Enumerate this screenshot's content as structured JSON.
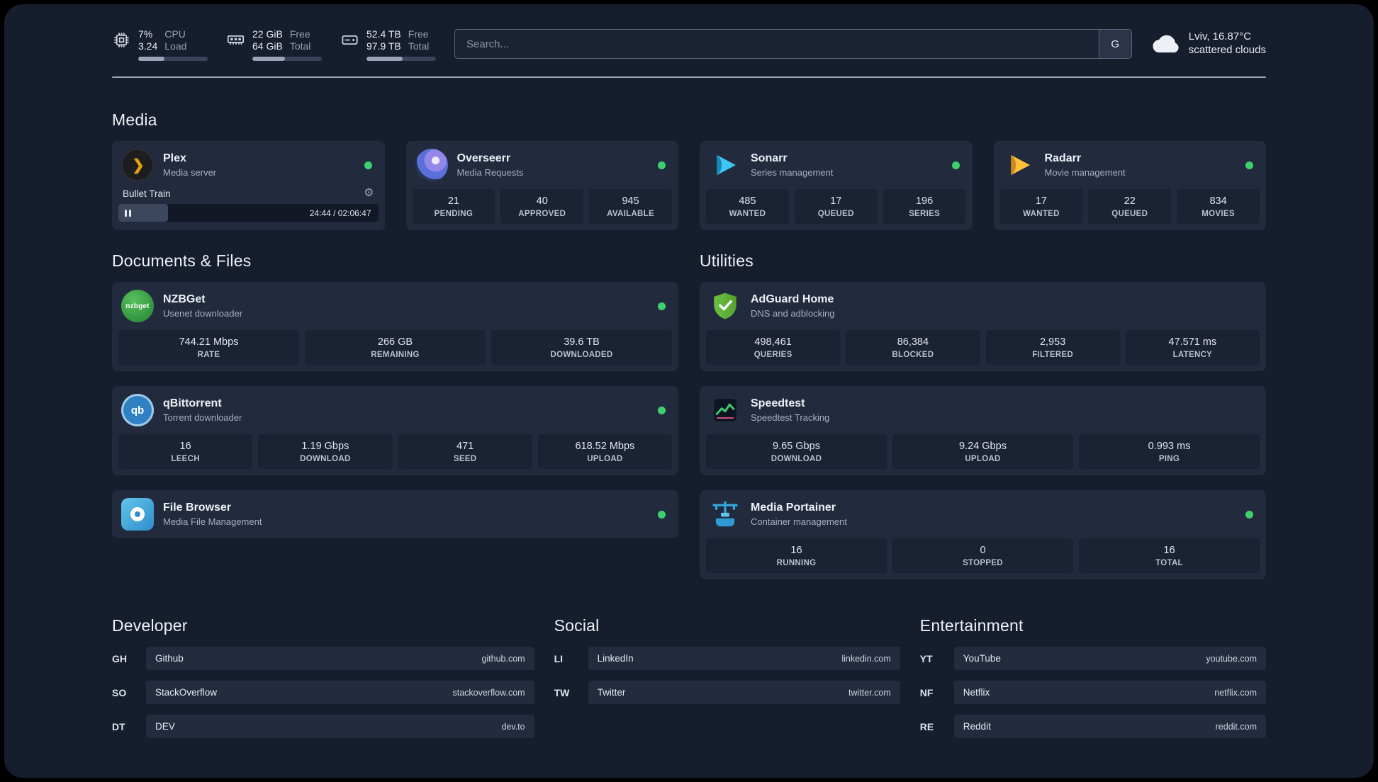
{
  "colors": {
    "status_green": "#3fd06e",
    "background": "#161d2d",
    "card": "#222b3e",
    "stat_box": "#1a2233"
  },
  "icons": {
    "gear": "⚙",
    "plex_chevron": "❯",
    "nzbget_text": "nzbget",
    "qb_text": "qb"
  },
  "topbar": {
    "cpu": {
      "value1": "7%",
      "value2": "3.24",
      "label1": "CPU",
      "label2": "Load",
      "bar_percent": 38
    },
    "ram": {
      "value1": "22 GiB",
      "value2": "64 GiB",
      "label1": "Free",
      "label2": "Total",
      "bar_percent": 47
    },
    "disk": {
      "value1": "52.4 TB",
      "value2": "97.9 TB",
      "label1": "Free",
      "label2": "Total",
      "bar_percent": 52
    },
    "search": {
      "placeholder": "Search...",
      "button_label": "G"
    },
    "weather": {
      "location": "Lviv, 16.87°C",
      "condition": "scattered clouds"
    }
  },
  "media": {
    "title": "Media",
    "plex": {
      "name": "Plex",
      "subtitle": "Media server",
      "now_playing": "Bullet Train",
      "time": "24:44 / 02:06:47",
      "progress_percent": 19
    },
    "overseerr": {
      "name": "Overseerr",
      "subtitle": "Media Requests",
      "stats": [
        {
          "value": "21",
          "label": "PENDING"
        },
        {
          "value": "40",
          "label": "APPROVED"
        },
        {
          "value": "945",
          "label": "AVAILABLE"
        }
      ]
    },
    "sonarr": {
      "name": "Sonarr",
      "subtitle": "Series management",
      "stats": [
        {
          "value": "485",
          "label": "WANTED"
        },
        {
          "value": "17",
          "label": "QUEUED"
        },
        {
          "value": "196",
          "label": "SERIES"
        }
      ]
    },
    "radarr": {
      "name": "Radarr",
      "subtitle": "Movie management",
      "stats": [
        {
          "value": "17",
          "label": "WANTED"
        },
        {
          "value": "22",
          "label": "QUEUED"
        },
        {
          "value": "834",
          "label": "MOVIES"
        }
      ]
    }
  },
  "documents": {
    "title": "Documents & Files",
    "nzbget": {
      "name": "NZBGet",
      "subtitle": "Usenet downloader",
      "stats": [
        {
          "value": "744.21 Mbps",
          "label": "RATE"
        },
        {
          "value": "266 GB",
          "label": "REMAINING"
        },
        {
          "value": "39.6 TB",
          "label": "DOWNLOADED"
        }
      ]
    },
    "qbittorrent": {
      "name": "qBittorrent",
      "subtitle": "Torrent downloader",
      "stats": [
        {
          "value": "16",
          "label": "LEECH"
        },
        {
          "value": "1.19 Gbps",
          "label": "DOWNLOAD"
        },
        {
          "value": "471",
          "label": "SEED"
        },
        {
          "value": "618.52 Mbps",
          "label": "UPLOAD"
        }
      ]
    },
    "filebrowser": {
      "name": "File Browser",
      "subtitle": "Media File Management"
    }
  },
  "utilities": {
    "title": "Utilities",
    "adguard": {
      "name": "AdGuard Home",
      "subtitle": "DNS and adblocking",
      "stats": [
        {
          "value": "498,461",
          "label": "QUERIES"
        },
        {
          "value": "86,384",
          "label": "BLOCKED"
        },
        {
          "value": "2,953",
          "label": "FILTERED"
        },
        {
          "value": "47.571 ms",
          "label": "LATENCY"
        }
      ]
    },
    "speedtest": {
      "name": "Speedtest",
      "subtitle": "Speedtest Tracking",
      "stats": [
        {
          "value": "9.65 Gbps",
          "label": "DOWNLOAD"
        },
        {
          "value": "9.24 Gbps",
          "label": "UPLOAD"
        },
        {
          "value": "0.993 ms",
          "label": "PING"
        }
      ]
    },
    "portainer": {
      "name": "Media Portainer",
      "subtitle": "Container management",
      "stats": [
        {
          "value": "16",
          "label": "RUNNING"
        },
        {
          "value": "0",
          "label": "STOPPED"
        },
        {
          "value": "16",
          "label": "TOTAL"
        }
      ]
    }
  },
  "bookmarks": {
    "developer": {
      "title": "Developer",
      "links": [
        {
          "abbr": "GH",
          "name": "Github",
          "url": "github.com"
        },
        {
          "abbr": "SO",
          "name": "StackOverflow",
          "url": "stackoverflow.com"
        },
        {
          "abbr": "DT",
          "name": "DEV",
          "url": "dev.to"
        }
      ]
    },
    "social": {
      "title": "Social",
      "links": [
        {
          "abbr": "LI",
          "name": "LinkedIn",
          "url": "linkedin.com"
        },
        {
          "abbr": "TW",
          "name": "Twitter",
          "url": "twitter.com"
        }
      ]
    },
    "entertainment": {
      "title": "Entertainment",
      "links": [
        {
          "abbr": "YT",
          "name": "YouTube",
          "url": "youtube.com"
        },
        {
          "abbr": "NF",
          "name": "Netflix",
          "url": "netflix.com"
        },
        {
          "abbr": "RE",
          "name": "Reddit",
          "url": "reddit.com"
        }
      ]
    }
  }
}
